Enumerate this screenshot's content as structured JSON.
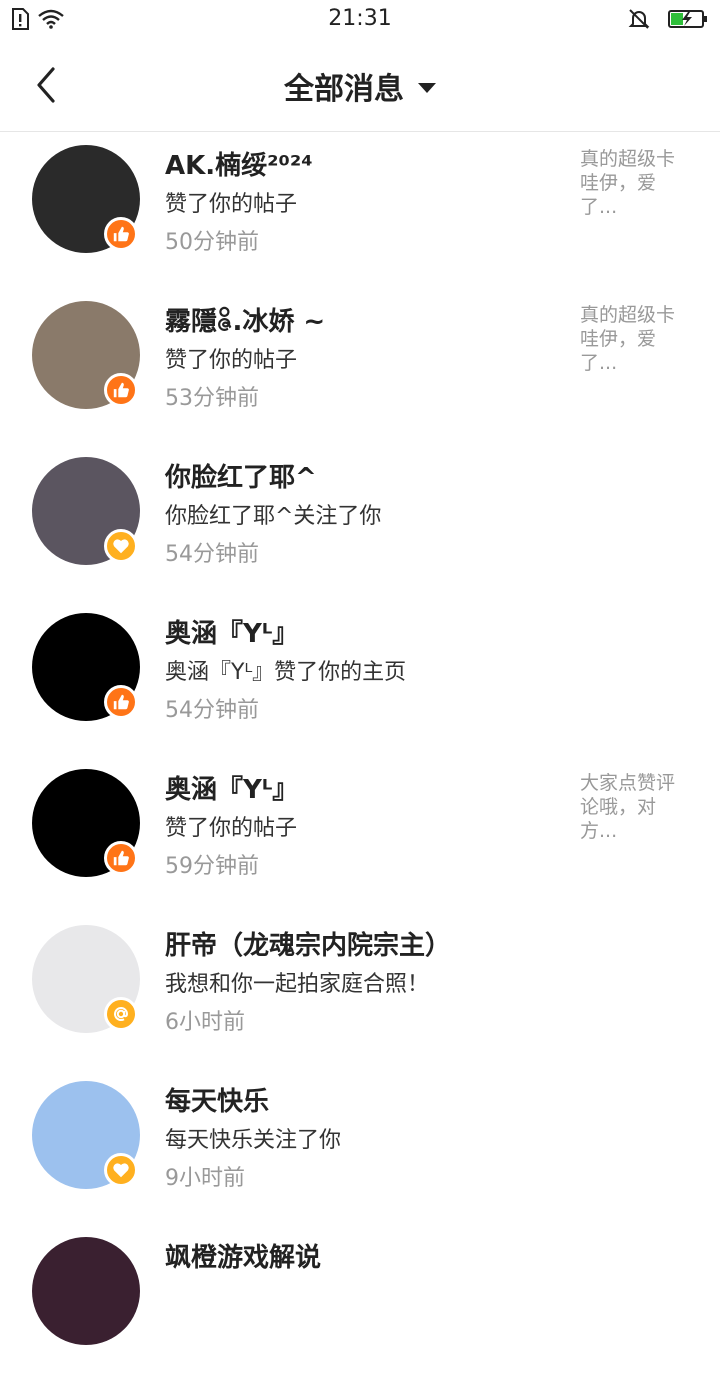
{
  "status": {
    "time": "21:31"
  },
  "header": {
    "title": "全部消息"
  },
  "messages": [
    {
      "name": "AK.楠绥²⁰²⁴",
      "action": "赞了你的帖子",
      "time": "50分钟前",
      "preview_lines": [
        "真的超级卡",
        "哇伊，爱",
        "了..."
      ],
      "badge": "thumbs-up-icon",
      "badge_color": "#ff7417",
      "avatar_color": "#2a2a2a"
    },
    {
      "name": "霧隱ဇိ.冰娇 ~",
      "action": "赞了你的帖子",
      "time": "53分钟前",
      "preview_lines": [
        "真的超级卡",
        "哇伊，爱",
        "了..."
      ],
      "badge": "thumbs-up-icon",
      "badge_color": "#ff7417",
      "avatar_color": "#8a7a6a"
    },
    {
      "name": "你脸红了耶^",
      "action": "你脸红了耶^关注了你",
      "time": "54分钟前",
      "preview_lines": [],
      "badge": "heart-icon",
      "badge_color": "#ffb01f",
      "avatar_color": "#5b5560"
    },
    {
      "name": "奥涵『Yᴸ』",
      "action": "奥涵『Yᴸ』赞了你的主页",
      "time": "54分钟前",
      "preview_lines": [],
      "badge": "thumbs-up-icon",
      "badge_color": "#ff7417",
      "avatar_color": "#000000"
    },
    {
      "name": "奥涵『Yᴸ』",
      "action": "赞了你的帖子",
      "time": "59分钟前",
      "preview_lines": [
        "大家点赞评",
        "论哦，对",
        "方..."
      ],
      "badge": "thumbs-up-icon",
      "badge_color": "#ff7417",
      "avatar_color": "#000000"
    },
    {
      "name": "肝帝（龙魂宗内院宗主）",
      "action": "我想和你一起拍家庭合照！",
      "time": "6小时前",
      "preview_lines": [],
      "badge": "at-icon",
      "badge_color": "#ffb01f",
      "avatar_color": "#e8e8ea"
    },
    {
      "name": "每天快乐",
      "action": "每天快乐关注了你",
      "time": "9小时前",
      "preview_lines": [],
      "badge": "heart-icon",
      "badge_color": "#ffb01f",
      "avatar_color": "#9cc1ee"
    },
    {
      "name": "飒橙游戏解说",
      "action": "",
      "time": "",
      "preview_lines": [],
      "badge": "",
      "badge_color": "#ffb01f",
      "avatar_color": "#3a2030"
    }
  ]
}
